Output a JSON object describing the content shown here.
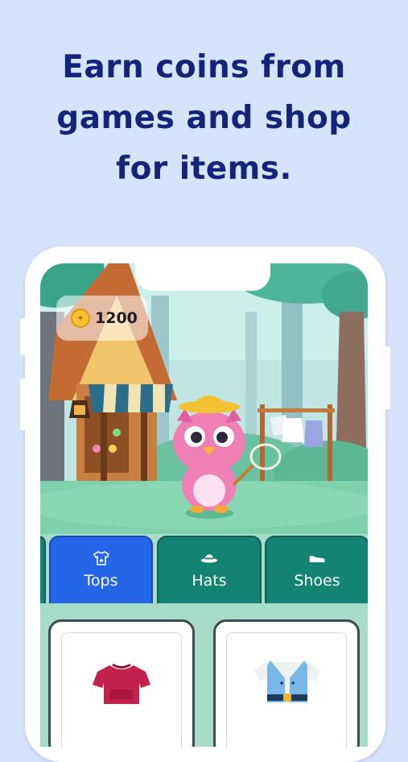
{
  "headline": {
    "line1": "Earn coins from",
    "line2": "games and shop",
    "line3": "for items."
  },
  "app": {
    "coins": {
      "icon": "coin-icon",
      "count": "1200"
    },
    "tabs": [
      {
        "label": "Tops",
        "icon": "shirt-icon",
        "active": true
      },
      {
        "label": "Hats",
        "icon": "hat-icon",
        "active": false
      },
      {
        "label": "Shoes",
        "icon": "shoe-icon",
        "active": false
      }
    ],
    "items": [
      {
        "name": "red-shirt",
        "icon": "red-top-icon"
      },
      {
        "name": "blue-vest-outfit",
        "icon": "vest-icon"
      }
    ]
  },
  "colors": {
    "background": "#d6e4fb",
    "headline": "#14247a",
    "tab_active": "#2565e8",
    "tab_inactive": "#138374",
    "panel": "#a7dcc8"
  }
}
